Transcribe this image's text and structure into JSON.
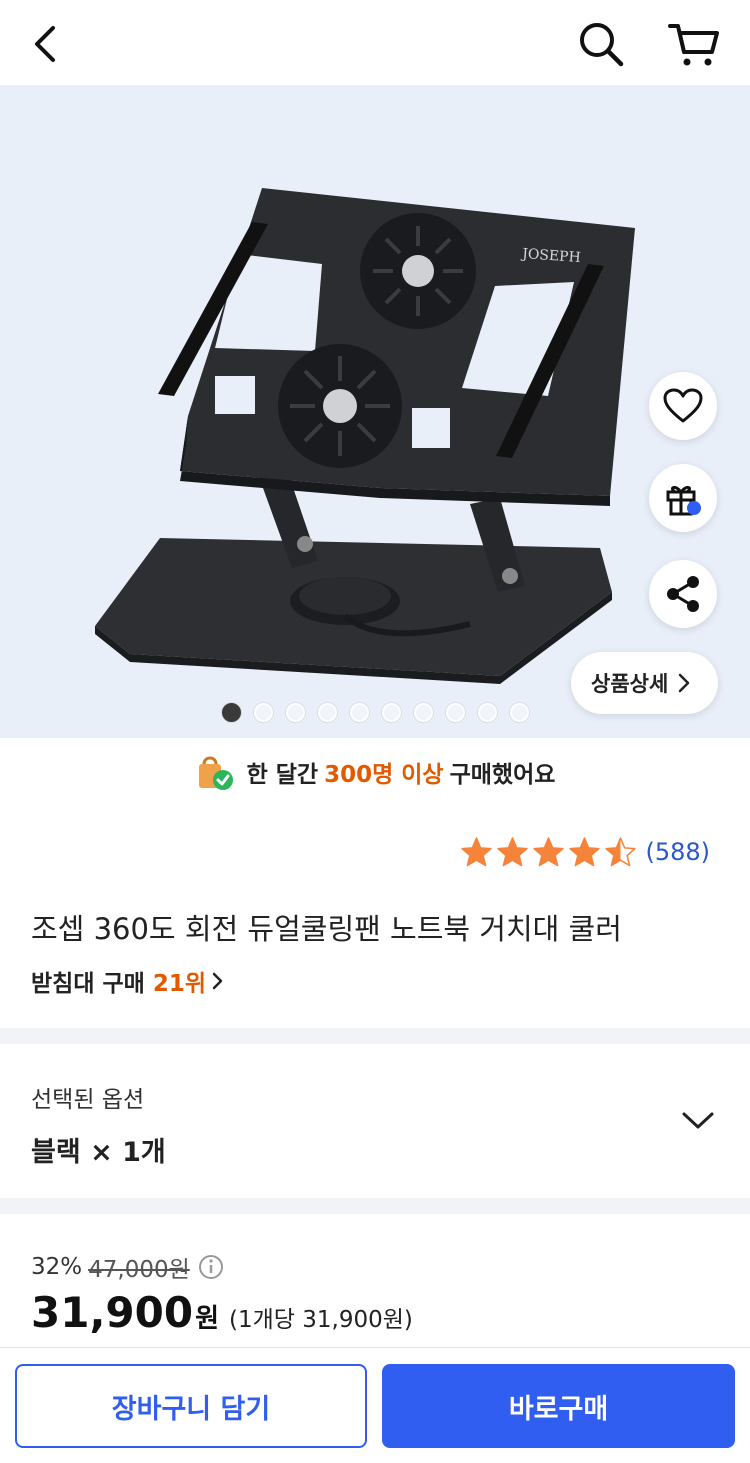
{
  "header": {
    "back_icon": "chevron-left-icon",
    "search_icon": "search-icon",
    "cart_icon": "cart-icon"
  },
  "hero": {
    "brand_on_product": "JOSEPH",
    "detail_button_label": "상품상세",
    "actions": [
      "heart-icon",
      "gift-icon",
      "share-icon"
    ],
    "carousel": {
      "total": 10,
      "active": 1
    }
  },
  "banner": {
    "prefix": "한 달간",
    "highlight": "300명 이상",
    "suffix": "구매했어요"
  },
  "rating": {
    "stars": 4.5,
    "count_text": "(588)",
    "star_color": "#f5843a"
  },
  "product": {
    "title": "조셉 360도 회전 듀얼쿨링팬 노트북 거치대 쿨러",
    "rank_label": "받침대 구매",
    "rank_value": "21위"
  },
  "option": {
    "label": "선택된 옵션",
    "value": "블랙 × 1개"
  },
  "price": {
    "discount": "32%",
    "original": "47,000원",
    "amount": "31,900",
    "unit": "원",
    "per_unit": "(1개당 31,900원)"
  },
  "actions": {
    "cart_label": "장바구니 담기",
    "buy_label": "바로구매",
    "accent": "#2f5ef0",
    "highlight": "#e05b00"
  }
}
